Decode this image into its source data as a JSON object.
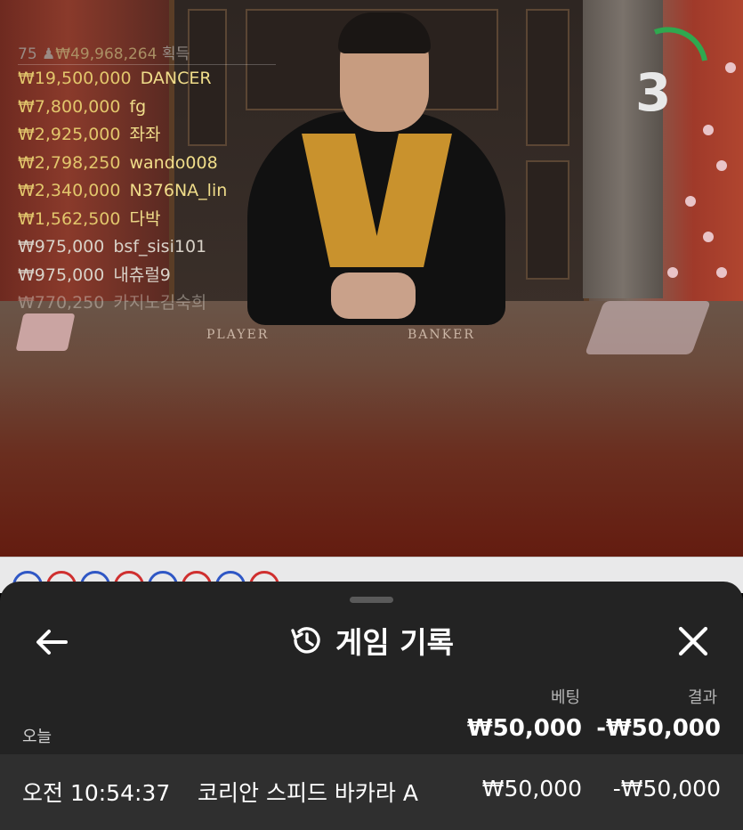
{
  "live": {
    "winners_header": {
      "count": "75",
      "total": "₩49,968,264",
      "label": "획득"
    },
    "winners": [
      {
        "amount": "₩19,500,000",
        "name": "DANCER"
      },
      {
        "amount": "₩7,800,000",
        "name": "fg"
      },
      {
        "amount": "₩2,925,000",
        "name": "좌좌"
      },
      {
        "amount": "₩2,798,250",
        "name": "wando008"
      },
      {
        "amount": "₩2,340,000",
        "name": "N376NA_lin"
      },
      {
        "amount": "₩1,562,500",
        "name": "다박"
      },
      {
        "amount": "₩975,000",
        "name": "bsf_sisi101"
      },
      {
        "amount": "₩975,000",
        "name": "내츄럴9"
      },
      {
        "amount": "₩770,250",
        "name": "카지노김숙희"
      }
    ],
    "countdown": "3",
    "table_labels": {
      "player": "PLAYER",
      "banker": "BANKER"
    },
    "colors": {
      "timer_arc": "#2fa84f",
      "player": "#2f57c5",
      "banker": "#cf2f2f"
    }
  },
  "roadmap": {
    "circles": [
      "blue",
      "red",
      "blue",
      "red",
      "blue",
      "red",
      "blue",
      "red"
    ]
  },
  "sheet": {
    "title": "게임 기록",
    "title_icon": "history-icon",
    "back_icon": "arrow-left-icon",
    "close_icon": "close-icon",
    "columns": {
      "bet": "베팅",
      "result": "결과"
    },
    "date_group": {
      "label": "오늘",
      "total_bet": "₩50,000",
      "total_result": "-₩50,000"
    },
    "rows": [
      {
        "time": "오전 10:54:37",
        "game": "코리안 스피드 바카라 A",
        "bet": "₩50,000",
        "result": "-₩50,000"
      }
    ]
  }
}
